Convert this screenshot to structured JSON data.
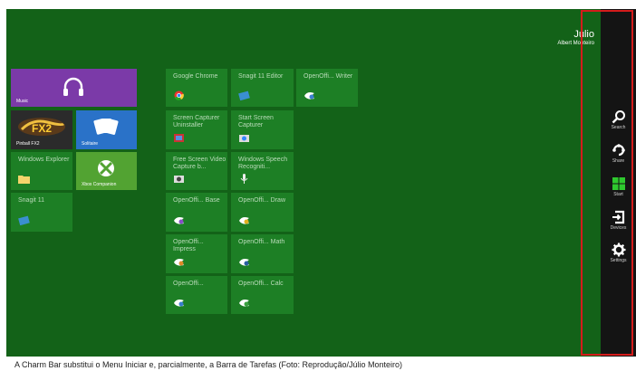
{
  "user": {
    "name": "Júlio",
    "subtitle": "Albert Monteiro"
  },
  "tiles": [
    {
      "label": "Music"
    },
    {
      "label": "Pinball FX2"
    },
    {
      "label": "Solitaire"
    },
    {
      "label": "Windows Explorer"
    },
    {
      "label": "Xbox Companion"
    },
    {
      "label": "Snagit 11"
    },
    {
      "label": "Google Chrome"
    },
    {
      "label": "Snagit 11 Editor"
    },
    {
      "label": "OpenOffi... Writer"
    },
    {
      "label": "Screen Capturer Uninstaller"
    },
    {
      "label": "Start Screen Capturer"
    },
    {
      "label": "Free Screen Video Capture b..."
    },
    {
      "label": "Windows Speech Recogniti..."
    },
    {
      "label": "OpenOffi... Base"
    },
    {
      "label": "OpenOffi... Draw"
    },
    {
      "label": "OpenOffi... Impress"
    },
    {
      "label": "OpenOffi... Math"
    },
    {
      "label": "OpenOffi..."
    },
    {
      "label": "OpenOffi... Calc"
    }
  ],
  "charms": [
    {
      "label": "Search",
      "icon": "search-icon"
    },
    {
      "label": "Share",
      "icon": "share-icon"
    },
    {
      "label": "Start",
      "icon": "windows-start-icon"
    },
    {
      "label": "Devices",
      "icon": "devices-icon"
    },
    {
      "label": "Settings",
      "icon": "gear-icon"
    }
  ],
  "caption": "A Charm Bar substitui o Menu Iniciar e, parcialmente, a Barra de Tarefas (Foto: Reprodução/Júlio Monteiro)",
  "colors": {
    "background": "#136218",
    "tile": "#1d7f25",
    "charm_bar": "#141414",
    "highlight": "#d41c1c"
  }
}
